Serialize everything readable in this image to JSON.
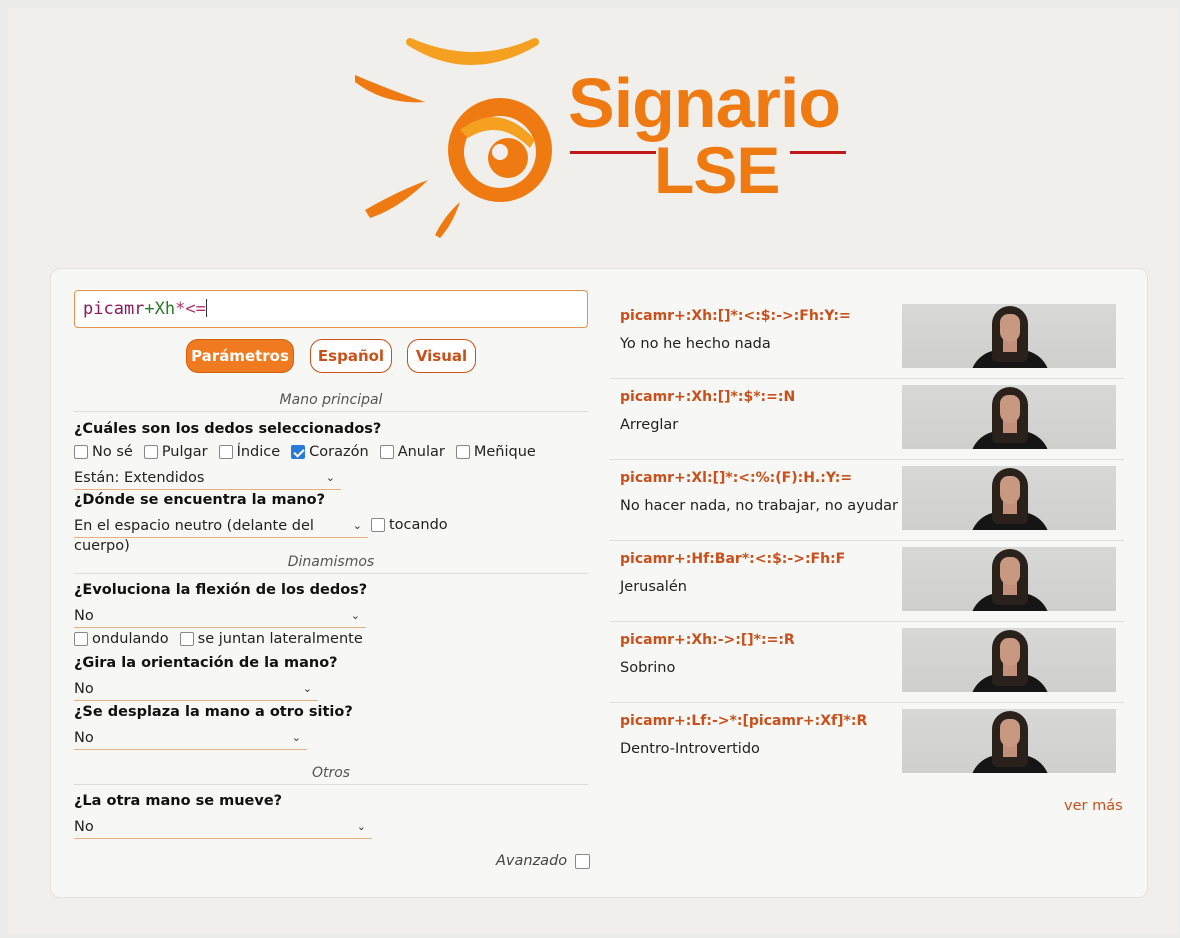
{
  "header": {
    "logo_title": "Signario",
    "logo_sub": "LSE"
  },
  "search": {
    "query_parts": [
      "picamr",
      "+",
      "Xh",
      "*",
      "<="
    ]
  },
  "tabs": [
    {
      "label": "Parámetros",
      "active": true
    },
    {
      "label": "Español",
      "active": false
    },
    {
      "label": "Visual",
      "active": false
    }
  ],
  "form": {
    "section_main": "Mano principal",
    "q_fingers": "¿Cuáles son los dedos seleccionados?",
    "fingers": [
      {
        "label": "No sé",
        "checked": false
      },
      {
        "label": "Pulgar",
        "checked": false
      },
      {
        "label": "Índice",
        "checked": false
      },
      {
        "label": "Corazón",
        "checked": true
      },
      {
        "label": "Anular",
        "checked": false
      },
      {
        "label": "Meñique",
        "checked": false
      }
    ],
    "fingers_state": "Están: Extendidos",
    "q_location": "¿Dónde se encuentra la mano?",
    "location_value": "En el espacio neutro (delante del cuerpo)",
    "touching_label": "tocando",
    "section_dyn": "Dinamismos",
    "q_flex": "¿Evoluciona la flexión de los dedos?",
    "flex_value": "No",
    "wave_label": "ondulando",
    "lateral_label": "se juntan lateralmente",
    "q_orient": "¿Gira la orientación de la mano?",
    "orient_value": "No",
    "q_move": "¿Se desplaza la mano a otro sitio?",
    "move_value": "No",
    "section_other": "Otros",
    "q_other": "¿La otra mano se mueve?",
    "other_value": "No",
    "advanced_label": "Avanzado"
  },
  "results": [
    {
      "code": "picamr+:Xh:[]*:<:$:->:Fh:Y:=",
      "gloss": "Yo no he hecho nada"
    },
    {
      "code": "picamr+:Xh:[]*:$*:=:N",
      "gloss": "Arreglar"
    },
    {
      "code": "picamr+:Xl:[]*:<:%:(F):H.:Y:=",
      "gloss": "No hacer nada, no trabajar, no ayudar"
    },
    {
      "code": "picamr+:Hf:Bar*:<:$:->:Fh:F",
      "gloss": "Jerusalén"
    },
    {
      "code": "picamr+:Xh:->:[]*:=:R",
      "gloss": "Sobrino"
    },
    {
      "code": "picamr+:Lf:->*:[picamr+:Xf]*:R",
      "gloss": "Dentro-Introvertido"
    }
  ],
  "more_label": "ver más",
  "colors": {
    "accent": "#f07a20",
    "accent_dark": "#c9501a",
    "logo_line": "#c01818"
  }
}
